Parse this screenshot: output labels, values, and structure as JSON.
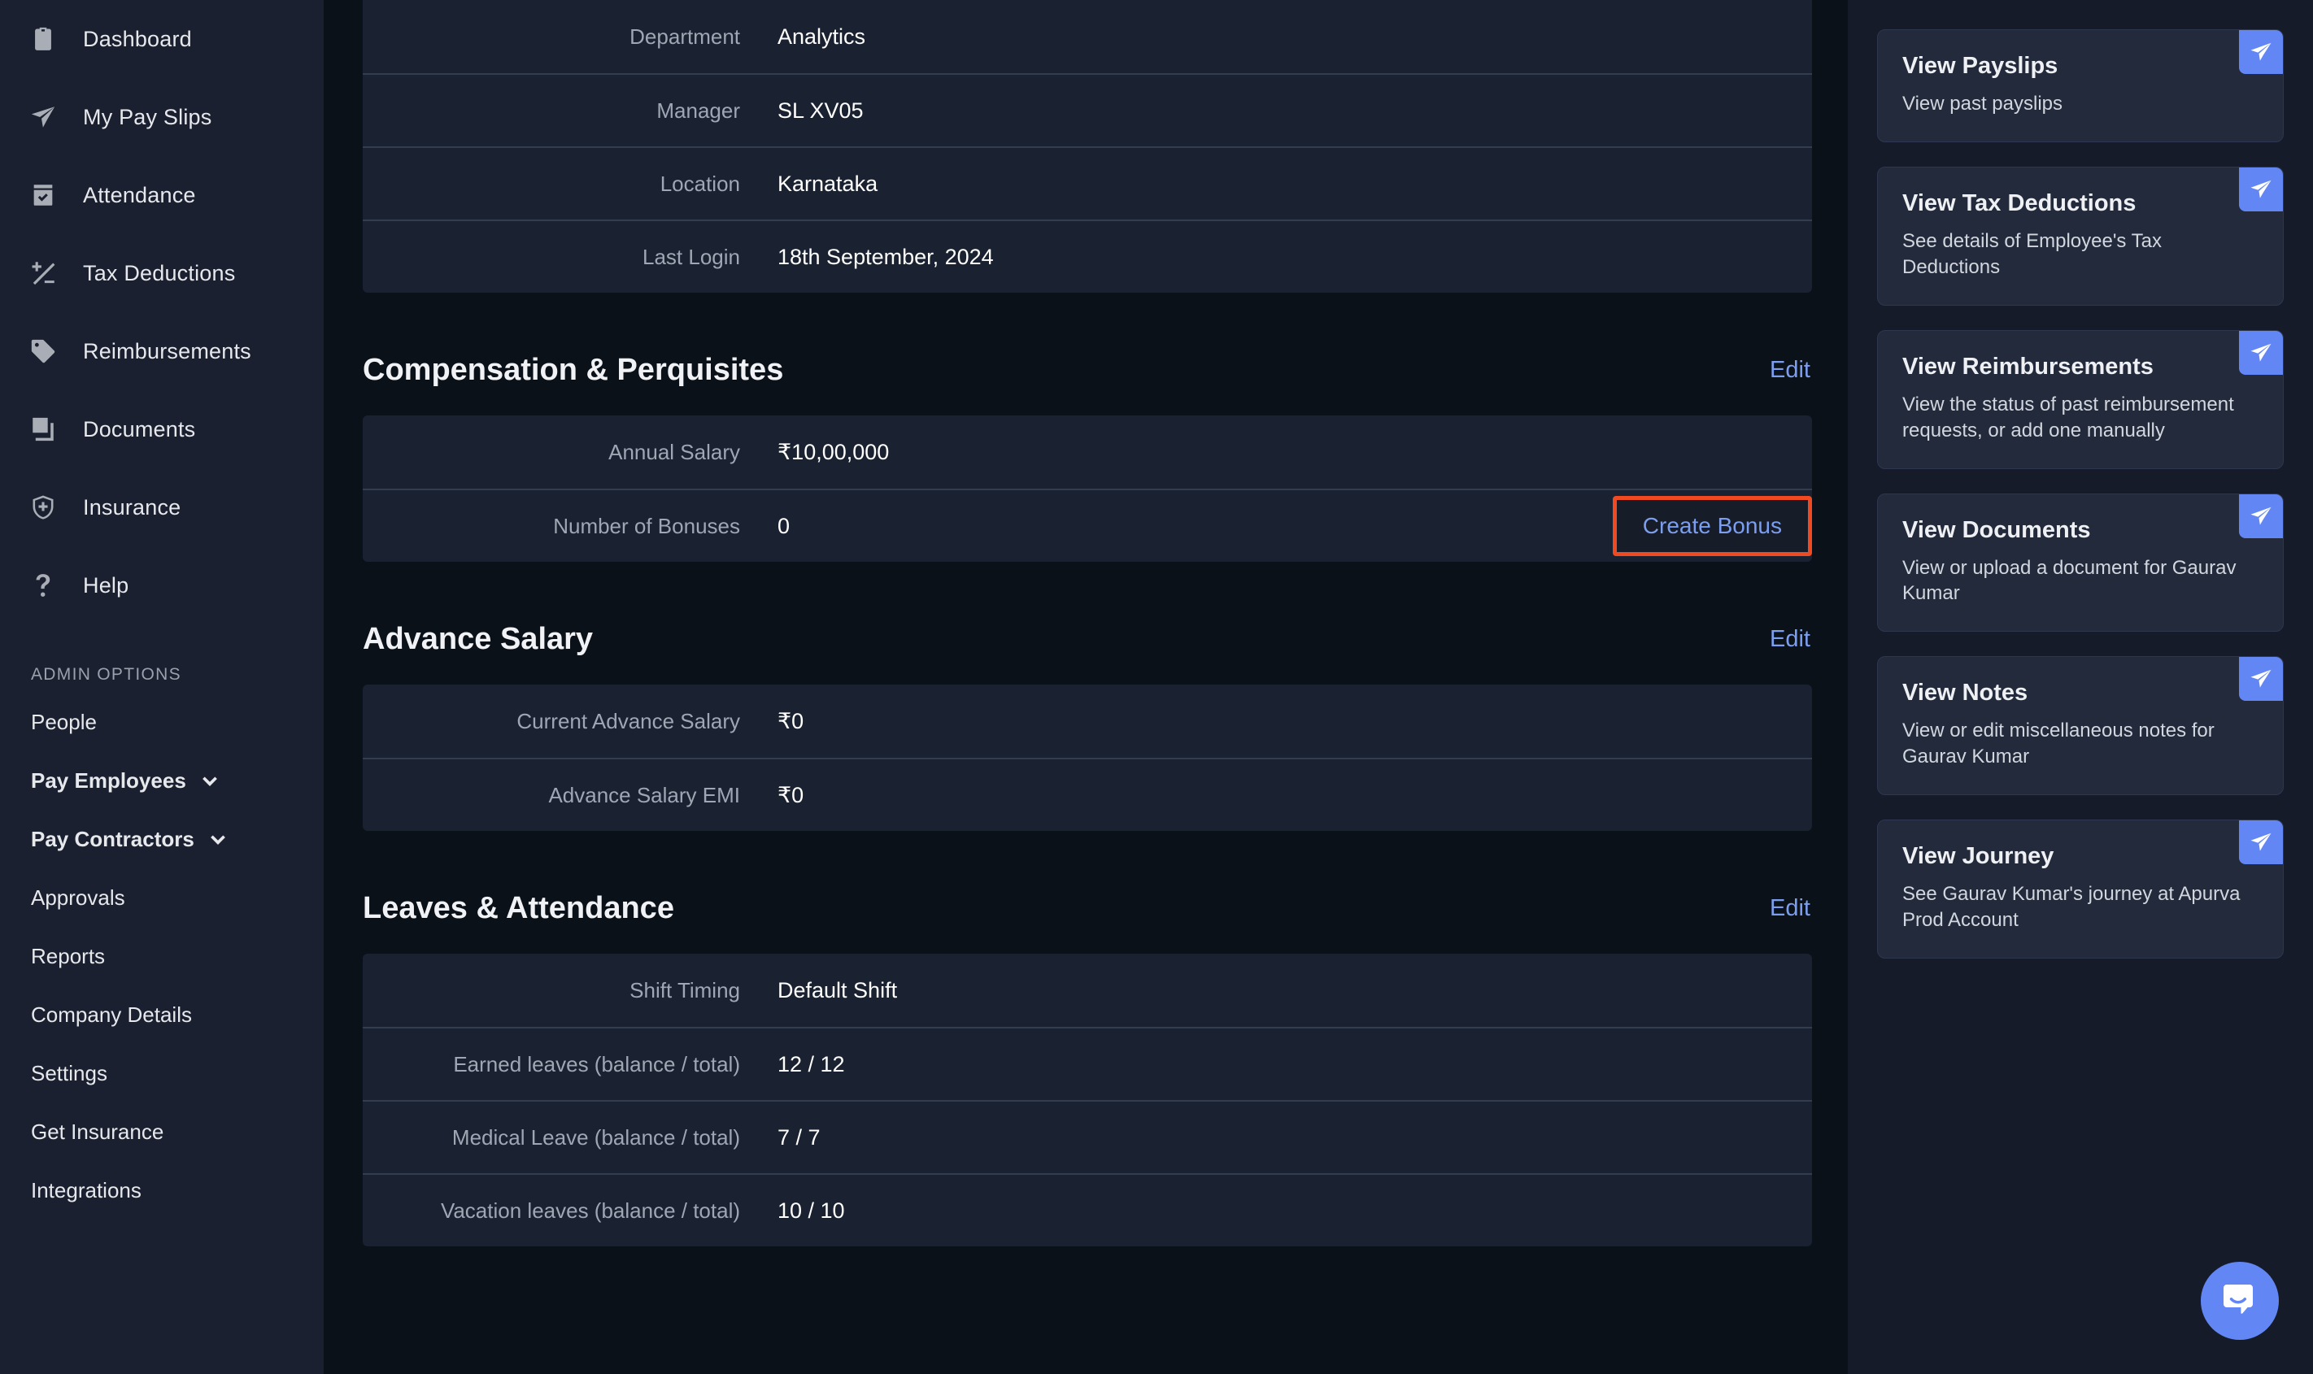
{
  "sidebar": {
    "nav_items": [
      {
        "label": "Dashboard",
        "icon": "clipboard-icon"
      },
      {
        "label": "My Pay Slips",
        "icon": "paper-plane-icon"
      },
      {
        "label": "Attendance",
        "icon": "calendar-check-icon"
      },
      {
        "label": "Tax Deductions",
        "icon": "plus-minus-icon"
      },
      {
        "label": "Reimbursements",
        "icon": "tag-icon"
      },
      {
        "label": "Documents",
        "icon": "documents-icon"
      },
      {
        "label": "Insurance",
        "icon": "shield-plus-icon"
      },
      {
        "label": "Help",
        "icon": "question-mark-icon"
      }
    ],
    "admin_section_label": "ADMIN OPTIONS",
    "admin_items": [
      {
        "label": "People",
        "expandable": false
      },
      {
        "label": "Pay Employees",
        "expandable": true
      },
      {
        "label": "Pay Contractors",
        "expandable": true
      },
      {
        "label": "Approvals",
        "expandable": false
      },
      {
        "label": "Reports",
        "expandable": false
      },
      {
        "label": "Company Details",
        "expandable": false
      },
      {
        "label": "Settings",
        "expandable": false
      },
      {
        "label": "Get Insurance",
        "expandable": false
      },
      {
        "label": "Integrations",
        "expandable": false
      }
    ]
  },
  "main": {
    "profile_table": {
      "rows": [
        {
          "label": "Department",
          "value": "Analytics"
        },
        {
          "label": "Manager",
          "value": "SL XV05"
        },
        {
          "label": "Location",
          "value": "Karnataka"
        },
        {
          "label": "Last Login",
          "value": "18th September, 2024"
        }
      ]
    },
    "sections": [
      {
        "title": "Compensation & Perquisites",
        "edit_label": "Edit",
        "rows": [
          {
            "label": "Annual Salary",
            "value": "₹10,00,000",
            "action": null
          },
          {
            "label": "Number of Bonuses",
            "value": "0",
            "action": "Create Bonus",
            "action_highlighted": true
          }
        ]
      },
      {
        "title": "Advance Salary",
        "edit_label": "Edit",
        "rows": [
          {
            "label": "Current Advance Salary",
            "value": "₹0",
            "action": null
          },
          {
            "label": "Advance Salary EMI",
            "value": "₹0",
            "action": null
          }
        ]
      },
      {
        "title": "Leaves & Attendance",
        "edit_label": "Edit",
        "rows": [
          {
            "label": "Shift Timing",
            "value": "Default Shift",
            "action": null
          },
          {
            "label": "Earned leaves (balance / total)",
            "value": "12 / 12",
            "action": null
          },
          {
            "label": "Medical Leave (balance / total)",
            "value": "7 / 7",
            "action": null
          },
          {
            "label": "Vacation leaves (balance / total)",
            "value": "10 / 10",
            "action": null
          }
        ]
      }
    ]
  },
  "right_panel": {
    "cards": [
      {
        "title": "View Payslips",
        "desc": "View past payslips",
        "badge_icon": "send-icon"
      },
      {
        "title": "View Tax Deductions",
        "desc": "See details of Employee's Tax Deductions",
        "badge_icon": "send-icon"
      },
      {
        "title": "View Reimbursements",
        "desc": "View the status of past reimbursement requests, or add one manually",
        "badge_icon": "send-icon"
      },
      {
        "title": "View Documents",
        "desc": "View or upload a document for Gaurav Kumar",
        "badge_icon": "send-icon"
      },
      {
        "title": "View Notes",
        "desc": "View or edit miscellaneous notes for Gaurav Kumar",
        "badge_icon": "send-icon"
      },
      {
        "title": "View Journey",
        "desc": "See Gaurav Kumar's journey at Apurva Prod Account",
        "badge_icon": "send-icon"
      }
    ]
  },
  "chat": {
    "icon": "chat-bubble-icon"
  },
  "colors": {
    "accent_blue": "#6287f5",
    "link_blue": "#7c9ef0",
    "highlight_orange": "#f04a23",
    "sidebar_bg": "#1a2030",
    "main_bg": "#0b1119",
    "panel_bg": "#151b28",
    "row_bg": "#1a2130"
  }
}
